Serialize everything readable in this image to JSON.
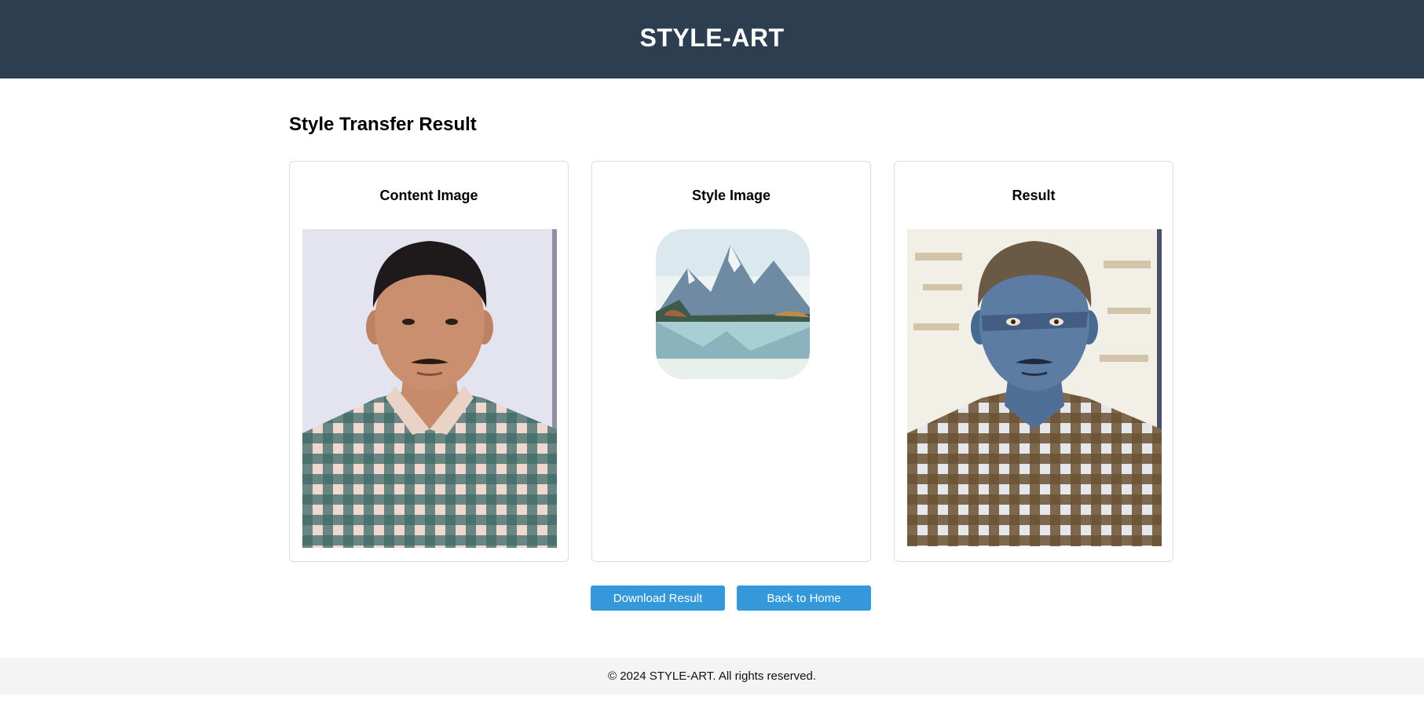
{
  "header": {
    "title": "STYLE-ART"
  },
  "main": {
    "title": "Style Transfer Result",
    "cards": {
      "content": {
        "label": "Content Image"
      },
      "style": {
        "label": "Style Image"
      },
      "result": {
        "label": "Result"
      }
    },
    "buttons": {
      "download": "Download Result",
      "home": "Back to Home"
    }
  },
  "footer": {
    "text": "© 2024 STYLE-ART. All rights reserved."
  },
  "colors": {
    "header_bg": "#2c3e50",
    "button_bg": "#3498db",
    "footer_bg": "#f4f4f4"
  }
}
